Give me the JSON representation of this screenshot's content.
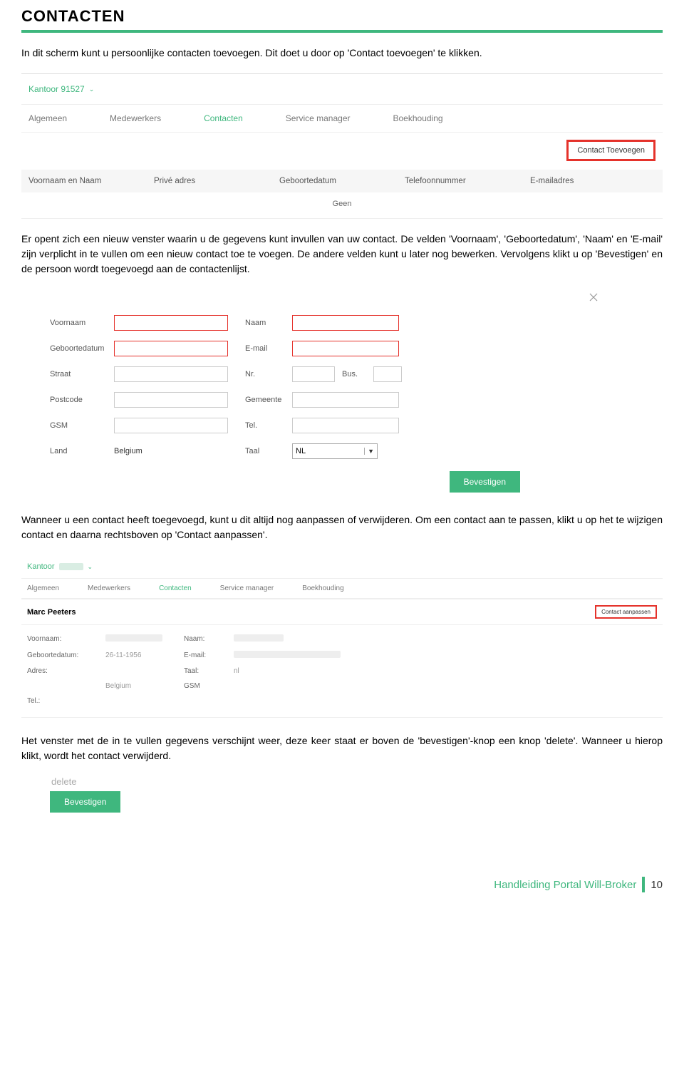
{
  "heading": "CONTACTEN",
  "para1": "In dit scherm kunt u persoonlijke contacten toevoegen. Dit doet u door op 'Contact toevoegen' te klikken.",
  "shot1": {
    "kantoor": "Kantoor 91527",
    "tabs": [
      "Algemeen",
      "Medewerkers",
      "Contacten",
      "Service manager",
      "Boekhouding"
    ],
    "addContactBtn": "Contact Toevoegen",
    "cols": [
      "Voornaam en Naam",
      "Privé adres",
      "Geboortedatum",
      "Telefoonnummer",
      "E-mailadres"
    ],
    "empty": "Geen"
  },
  "para2": "Er opent zich een nieuw venster waarin u de gegevens kunt invullen van uw contact. De velden 'Voornaam', 'Geboortedatum', 'Naam' en 'E-mail' zijn verplicht in te vullen om een nieuw contact toe te voegen. De andere velden kunt u later nog bewerken. Vervolgens klikt u op 'Bevestigen' en de persoon wordt toegevoegd aan de contactenlijst.",
  "shot2": {
    "labels": {
      "voornaam": "Voornaam",
      "naam": "Naam",
      "geboorte": "Geboortedatum",
      "email": "E-mail",
      "straat": "Straat",
      "nr": "Nr.",
      "bus": "Bus.",
      "postcode": "Postcode",
      "gemeente": "Gemeente",
      "gsm": "GSM",
      "tel": "Tel.",
      "land": "Land",
      "taal": "Taal"
    },
    "landValue": "Belgium",
    "taalValue": "NL",
    "confirmBtn": "Bevestigen"
  },
  "para3": "Wanneer u een contact heeft toegevoegd, kunt u dit altijd nog aanpassen of verwijderen. Om een contact aan te passen, klikt u op het te wijzigen contact en daarna rechtsboven op 'Contact aanpassen'.",
  "shot3": {
    "kantoor": "Kantoor",
    "tabs": [
      "Algemeen",
      "Medewerkers",
      "Contacten",
      "Service manager",
      "Boekhouding"
    ],
    "person": "Marc Peeters",
    "editBtn": "Contact aanpassen",
    "labels": {
      "voornaam": "Voornaam:",
      "naam": "Naam:",
      "geboorte": "Geboortedatum:",
      "email": "E-mail:",
      "adres": "Adres:",
      "taal": "Taal:",
      "land": "",
      "gsm": "GSM",
      "tel": "Tel.:"
    },
    "values": {
      "geboorte": "26-11-1956",
      "taal": "nl",
      "land": "Belgium"
    }
  },
  "para4": "Het venster met de in te vullen gegevens verschijnt weer, deze keer staat er boven de 'bevestigen'-knop een knop 'delete'. Wanneer u hierop klikt, wordt het contact verwijderd.",
  "shot4": {
    "delete": "delete",
    "confirm": "Bevestigen"
  },
  "footer": {
    "title": "Handleiding Portal Will-Broker",
    "page": "10"
  }
}
